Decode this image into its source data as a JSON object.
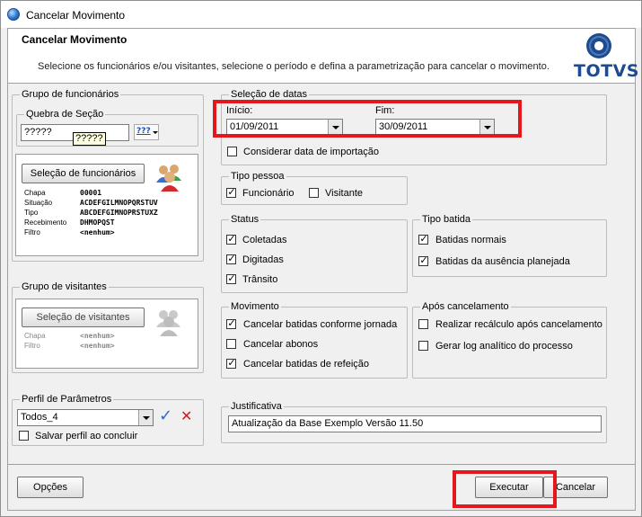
{
  "window": {
    "title": "Cancelar Movimento"
  },
  "header": {
    "title": "Cancelar Movimento",
    "description": "Selecione os funcionários e/ou visitantes, selecione o período e defina a parametrização para cancelar o movimento.",
    "logo_text": "TOTVS"
  },
  "grupo_funcionarios": {
    "legend": "Grupo de funcionários",
    "quebra_legend": "Quebra de Seção",
    "quebra_value": "?????",
    "quebra_tooltip": "?????",
    "filter_icon_text": "???",
    "selecao_button": "Seleção de funcionários",
    "fields": [
      {
        "key": "Chapa",
        "value": "00001"
      },
      {
        "key": "Situação",
        "value": "ACDEFGILMNOPQRSTUV"
      },
      {
        "key": "Tipo",
        "value": "ABCDEFGIMNOPRSTUXZ"
      },
      {
        "key": "Recebimento",
        "value": "DHMOPQST"
      },
      {
        "key": "Filtro",
        "value": "<nenhum>"
      }
    ]
  },
  "grupo_visitantes": {
    "legend": "Grupo de visitantes",
    "selecao_button": "Seleção de visitantes",
    "fields": [
      {
        "key": "Chapa",
        "value": "<nenhum>"
      },
      {
        "key": "Filtro",
        "value": "<nenhum>"
      }
    ]
  },
  "perfil": {
    "legend": "Perfil de Parâmetros",
    "value": "Todos_4",
    "salvar_label": "Salvar perfil ao concluir",
    "salvar_checked": false
  },
  "selecao_datas": {
    "legend": "Seleção de datas",
    "inicio_label": "Início:",
    "inicio_value": "01/09/2011",
    "fim_label": "Fim:",
    "fim_value": "30/09/2011",
    "considerar_label": "Considerar data de importação",
    "considerar_checked": false
  },
  "tipo_pessoa": {
    "legend": "Tipo pessoa",
    "funcionario_label": "Funcionário",
    "funcionario_checked": true,
    "visitante_label": "Visitante",
    "visitante_checked": false
  },
  "status": {
    "legend": "Status",
    "items": [
      {
        "label": "Coletadas",
        "checked": true
      },
      {
        "label": "Digitadas",
        "checked": true
      },
      {
        "label": "Trânsito",
        "checked": true
      }
    ]
  },
  "tipo_batida": {
    "legend": "Tipo batida",
    "items": [
      {
        "label": "Batidas normais",
        "checked": true
      },
      {
        "label": "Batidas da ausência planejada",
        "checked": true
      }
    ]
  },
  "movimento": {
    "legend": "Movimento",
    "items": [
      {
        "label": "Cancelar batidas conforme jornada",
        "checked": true
      },
      {
        "label": "Cancelar abonos",
        "checked": false
      },
      {
        "label": "Cancelar batidas de refeição",
        "checked": true
      }
    ]
  },
  "apos_cancelamento": {
    "legend": "Após cancelamento",
    "items": [
      {
        "label": "Realizar recálculo após cancelamento",
        "checked": false
      },
      {
        "label": "Gerar log analítico do processo",
        "checked": false
      }
    ]
  },
  "justificativa": {
    "legend": "Justificativa",
    "value": "Atualização da Base Exemplo Versão 11.50"
  },
  "footer": {
    "opcoes": "Opções",
    "executar": "Executar",
    "cancelar": "Cancelar"
  },
  "colors": {
    "highlight_red": "#e6161d",
    "brand_blue": "#1d4b8f"
  }
}
